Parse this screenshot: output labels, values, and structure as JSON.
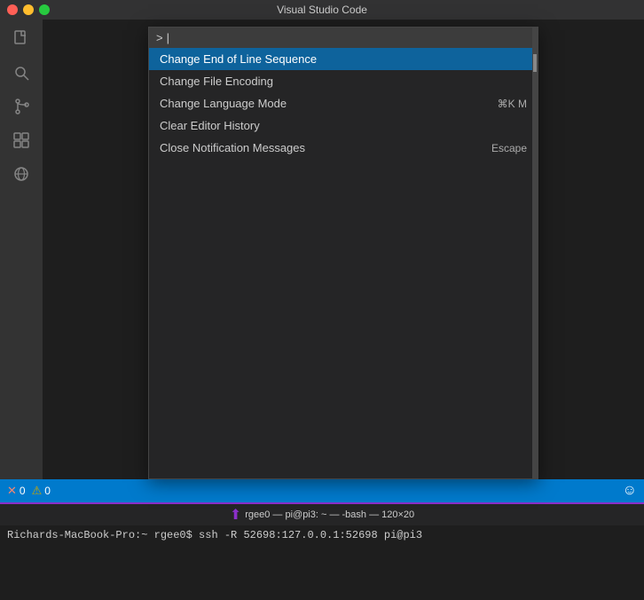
{
  "titleBar": {
    "title": "Visual Studio Code"
  },
  "activityBar": {
    "icons": [
      {
        "name": "files-icon",
        "symbol": "🗋"
      },
      {
        "name": "search-icon",
        "symbol": "🔍"
      },
      {
        "name": "source-control-icon",
        "symbol": "⎇"
      },
      {
        "name": "extensions-icon",
        "symbol": "⊞"
      },
      {
        "name": "remote-icon",
        "symbol": "⚙"
      }
    ]
  },
  "commandPalette": {
    "inputPrefix": ">",
    "inputCursor": "|",
    "items": [
      {
        "label": "Change End of Line Sequence",
        "shortcut": "",
        "selected": true
      },
      {
        "label": "Change File Encoding",
        "shortcut": "",
        "selected": false
      },
      {
        "label": "Change Language Mode",
        "shortcut": "⌘K M",
        "selected": false
      },
      {
        "label": "Clear Editor History",
        "shortcut": "",
        "selected": false
      },
      {
        "label": "Close Notification Messages",
        "shortcut": "Escape",
        "selected": false
      }
    ]
  },
  "statusBar": {
    "errorCount": "0",
    "warningCount": "0",
    "errorIcon": "✕",
    "warningIcon": "⚠",
    "smileyIcon": "☺"
  },
  "terminalPanel": {
    "tabArrow": "⬆",
    "tabLabel": "rgee0 — pi@pi3: ~ — -bash — 120×20",
    "promptText": "Richards-MacBook-Pro:~ rgee0$ ssh -R 52698:127.0.0.1:52698 pi@pi3"
  }
}
